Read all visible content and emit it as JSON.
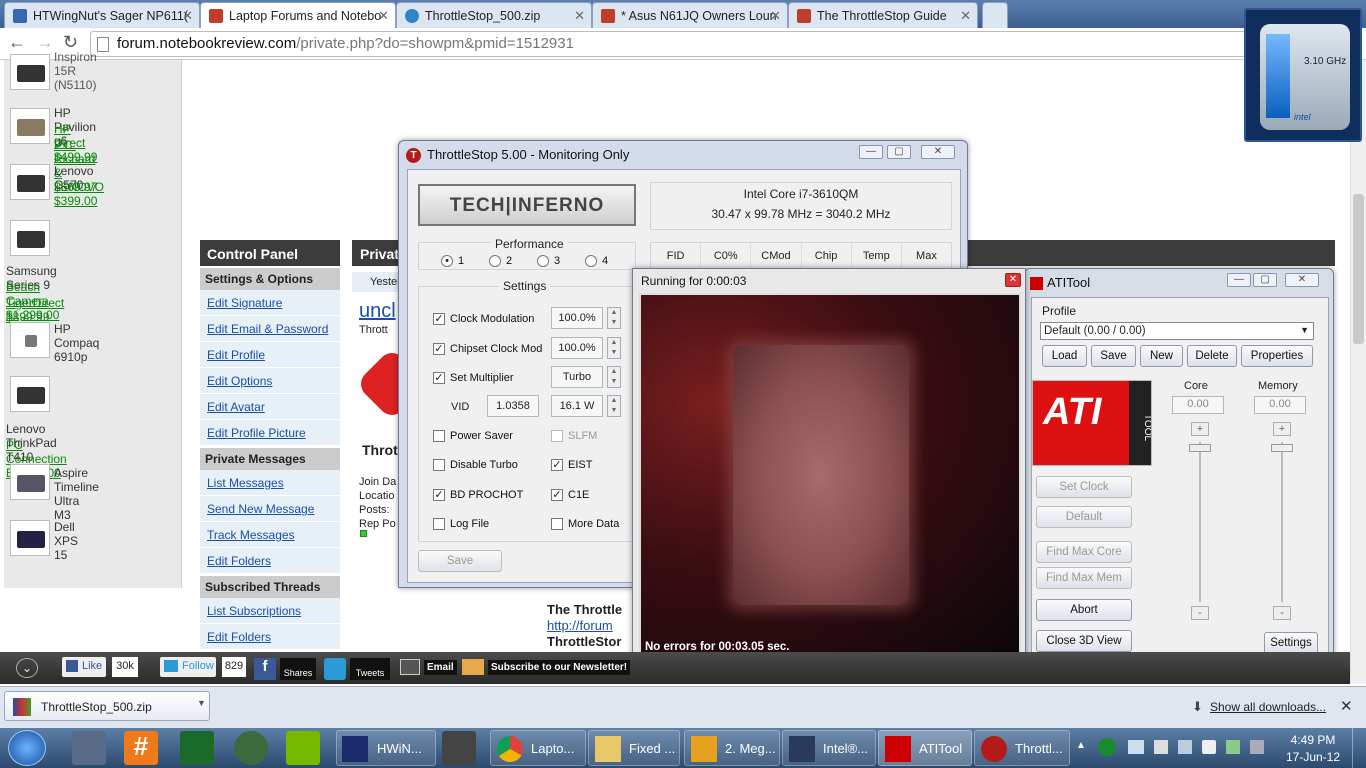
{
  "browser": {
    "tabs": [
      {
        "label": "HTWingNut's Sager NP611(",
        "color": "#3a66b0"
      },
      {
        "label": "Laptop Forums and Notebo",
        "color": "#c23c2a"
      },
      {
        "label": "ThrottleStop_500.zip",
        "color": "#2f86c9"
      },
      {
        "label": "* Asus N61JQ Owners Loun",
        "color": "#c23c2a"
      },
      {
        "label": "The ThrottleStop Guide",
        "color": "#c23c2a"
      }
    ],
    "url_host": "forum.notebookreview.com",
    "url_path": "/private.php?do=showpm&pmid=1512931"
  },
  "sidebar": {
    "cut_label": "Inspiron 15R (N5110)",
    "products": [
      {
        "name": "HP Pavilion g6",
        "links": [
          "HP Direct $499.99",
          "P.C. Richard & $569.97"
        ]
      },
      {
        "name": "Lenovo G570",
        "links": [
          "LENOVO $399.00"
        ]
      },
      {
        "name": "Samsung Series 9",
        "links": [
          "Beach Camera $1,299.00",
          "TigerDirect $899.99"
        ]
      },
      {
        "name": "HP Compaq 6910p",
        "links": []
      },
      {
        "name": "Lenovo ThinkPad T410",
        "links": [
          "PC Connection E $969.00"
        ]
      },
      {
        "name": "Aspire Timeline Ultra M3",
        "links": []
      },
      {
        "name": "Dell XPS 15",
        "links": []
      }
    ]
  },
  "control_panel": {
    "title": "Control Panel",
    "sections": [
      {
        "heading": "Settings & Options",
        "links": [
          "Edit Signature",
          "Edit Email & Password",
          "Edit Profile",
          "Edit Options",
          "Edit Avatar",
          "Edit Profile Picture"
        ]
      },
      {
        "heading": "Private Messages",
        "links": [
          "List Messages",
          "Send New Message",
          "Track Messages",
          "Edit Folders"
        ]
      },
      {
        "heading": "Subscribed Threads",
        "links": [
          "List Subscriptions",
          "Edit Folders"
        ]
      }
    ]
  },
  "message": {
    "header": "Privat",
    "date_prefix": "Yester",
    "user": "uncl",
    "user_sub": "Thrott",
    "user_name": "Throt",
    "join": "Join Da",
    "location": "Locatio",
    "posts": "Posts:",
    "rep": "Rep Po",
    "body_title": "The Throttle",
    "body_link": "http://forum",
    "body_sig": "ThrottleStor"
  },
  "throttlestop": {
    "title": "ThrottleStop 5.00 - Monitoring Only",
    "logo": "TECH|INFERNO",
    "cpu": "Intel Core i7-3610QM",
    "freq": "30.47 x 99.78 MHz = 3040.2 MHz",
    "performance_label": "Performance",
    "profiles": [
      "1",
      "2",
      "3",
      "4"
    ],
    "selected_profile": "1",
    "settings_label": "Settings",
    "columns": [
      "FID",
      "C0%",
      "CMod",
      "Chip",
      "Temp",
      "Max"
    ],
    "clock_mod": {
      "label": "Clock Modulation",
      "value": "100.0%"
    },
    "chipset_mod": {
      "label": "Chipset Clock Mod",
      "value": "100.0%"
    },
    "set_mult": {
      "label": "Set Multiplier",
      "value": "Turbo"
    },
    "vid_label": "VID",
    "vid": "1.0358",
    "power": "16.1 W",
    "power_saver": "Power Saver",
    "slfm": "SLFM",
    "disable_turbo": "Disable Turbo",
    "eist": "EIST",
    "bd_prochot": "BD PROCHOT",
    "c1e": "C1E",
    "log_file": "Log File",
    "more_data": "More Data",
    "save": "Save"
  },
  "furtest": {
    "title": "Running for 0:00:03",
    "status": "No errors for 00:03.05 sec."
  },
  "atitool": {
    "title": "ATITool",
    "profile_label": "Profile",
    "profile_value": "Default (0.00 / 0.00)",
    "buttons": [
      "Load",
      "Save",
      "New",
      "Delete",
      "Properties"
    ],
    "core_label": "Core",
    "memory_label": "Memory",
    "core_value": "0.00",
    "memory_value": "0.00",
    "set_clock": "Set Clock",
    "default": "Default",
    "find_max_core": "Find Max Core",
    "find_max_mem": "Find Max Mem",
    "abort": "Abort",
    "close_3d": "Close 3D View",
    "settings": "Settings",
    "logo_text": "ATI",
    "logo_sub": "TOOL"
  },
  "gadget": {
    "freq": "3.10 GHz",
    "brand": "intel"
  },
  "social": {
    "like": "Like",
    "likes": "30k",
    "follow": "Follow",
    "followers": "829",
    "shares": "Shares",
    "tweets": "Tweets",
    "email": "Email",
    "newsletter": "Subscribe to our Newsletter!"
  },
  "downloads": {
    "file": "ThrottleStop_500.zip",
    "show_all": "Show all downloads..."
  },
  "taskbar": {
    "items": [
      {
        "label": "HWiN..."
      },
      {
        "label": "Lapto..."
      },
      {
        "label": "Fixed ..."
      },
      {
        "label": "2. Meg..."
      },
      {
        "label": "Intel®..."
      },
      {
        "label": "ATITool"
      },
      {
        "label": "Throttl..."
      }
    ],
    "time": "4:49 PM",
    "date": "17-Jun-12"
  }
}
